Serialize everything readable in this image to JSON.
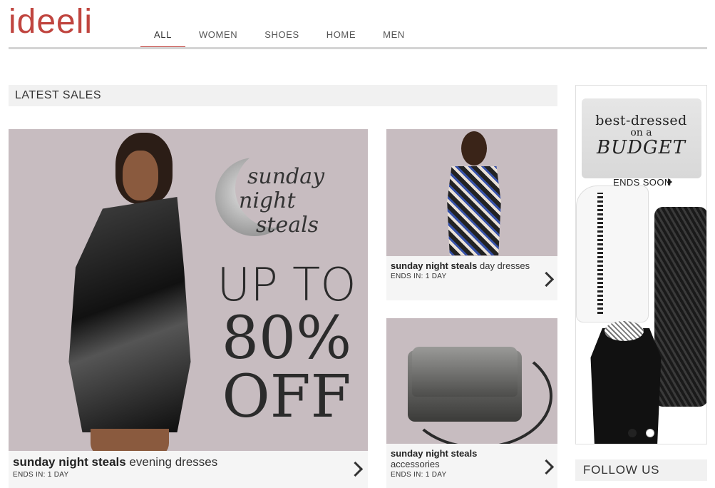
{
  "header": {
    "logo": "ideeli",
    "nav": [
      {
        "label": "ALL",
        "active": true
      },
      {
        "label": "WOMEN",
        "active": false
      },
      {
        "label": "SHOES",
        "active": false
      },
      {
        "label": "HOME",
        "active": false
      },
      {
        "label": "MEN",
        "active": false
      }
    ],
    "accent_color": "#c0453f"
  },
  "latest_sales": {
    "heading": "LATEST SALES",
    "featured": {
      "promo_script": [
        "sunday",
        "night",
        "steals"
      ],
      "promo_lines": [
        "UP TO",
        "80%",
        "OFF"
      ],
      "title_bold": "sunday night steals",
      "title_rest": " evening dresses",
      "ends": "ENDS IN: 1 DAY"
    },
    "tiles": [
      {
        "title_bold": "sunday night steals",
        "title_rest": " day dresses",
        "ends": "ENDS IN: 1 DAY"
      },
      {
        "title_bold": "sunday night steals",
        "title_rest": "accessories",
        "ends": "ENDS IN: 1 DAY"
      }
    ]
  },
  "sidebar": {
    "banner": {
      "line1": "best-dressed",
      "line2": "on a",
      "line3": "BUDGET",
      "ends": "ENDS SOON"
    },
    "follow": "FOLLOW US"
  }
}
